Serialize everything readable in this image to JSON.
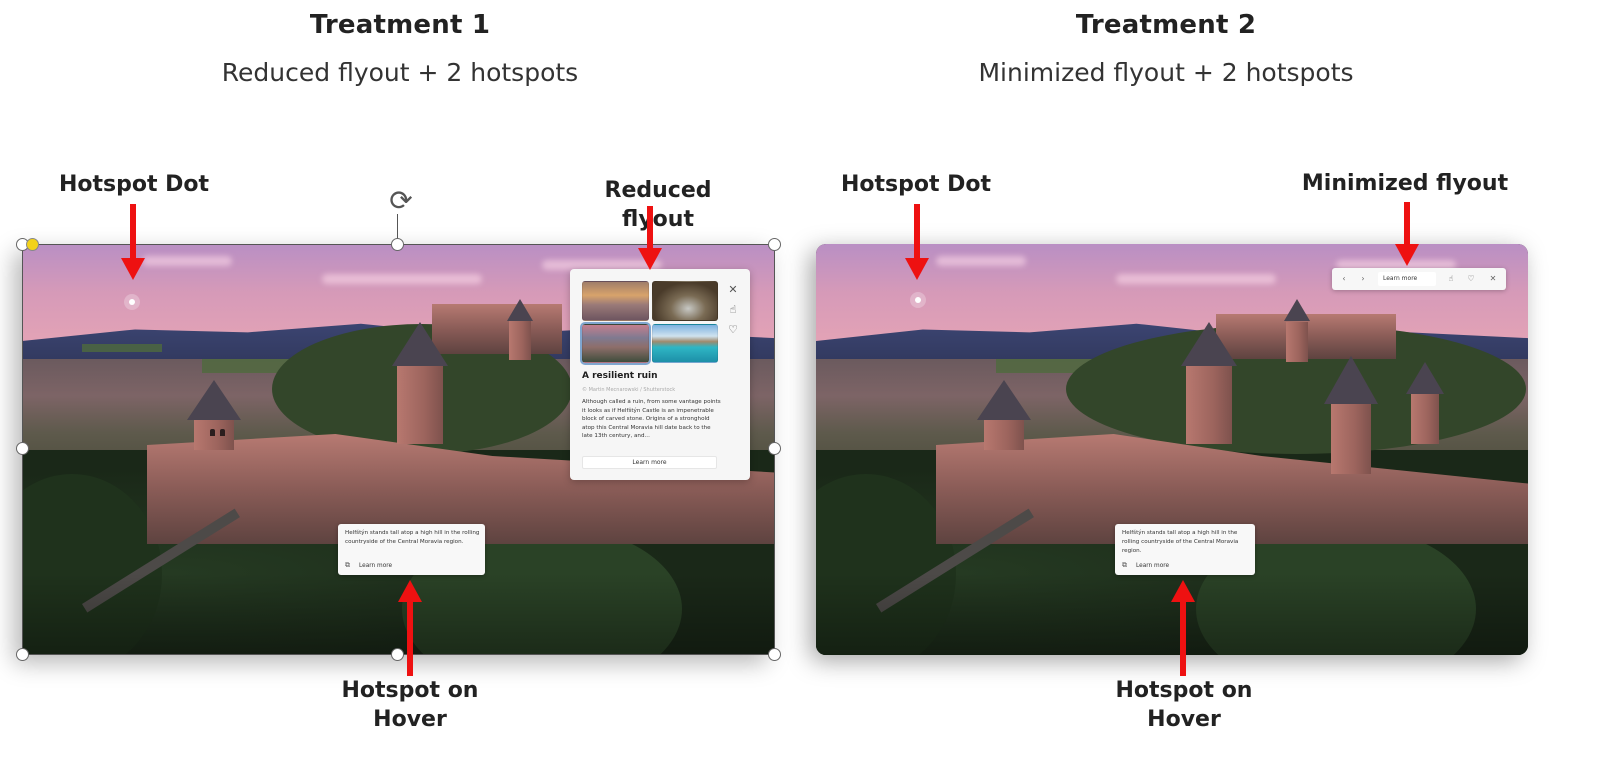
{
  "treatment1": {
    "title": "Treatment 1",
    "subtitle": "Reduced flyout + 2 hotspots",
    "labels": {
      "hotspot_dot": "Hotspot Dot",
      "flyout": "Reduced flyout",
      "hotspot_hover_line1": "Hotspot on",
      "hotspot_hover_line2": "Hover"
    },
    "flyout": {
      "title": "A resilient ruin",
      "credit": "© Martin Mecnarowski / Shutterstock",
      "body": "Although called a ruin, from some vantage points it looks as if Helfštýn Castle is an impenetrable block of carved stone. Origins of a stronghold atop this Central Moravia hill date back to the late 13th century, and...",
      "button": "Learn more",
      "icons": [
        "close-icon",
        "like-icon",
        "dislike-icon"
      ]
    },
    "hover_card": {
      "text": "Helfštýn stands tall atop a high hill in the rolling countryside of the Central Moravia region.",
      "link": "Learn more",
      "icon": "external-link-icon"
    }
  },
  "treatment2": {
    "title": "Treatment 2",
    "subtitle": "Minimized flyout + 2 hotspots",
    "labels": {
      "hotspot_dot": "Hotspot Dot",
      "flyout": "Minimized flyout",
      "hotspot_hover_line1": "Hotspot on",
      "hotspot_hover_line2": "Hover"
    },
    "mini_flyout": {
      "prev": "‹",
      "next": "›",
      "button": "Learn more",
      "like": "♡",
      "close": "✕"
    },
    "hover_card": {
      "text": "Helfštýn stands tall atop a high hill in the rolling countryside of the Central Moravia region.",
      "link": "Learn more",
      "icon": "external-link-icon"
    }
  },
  "glyphs": {
    "close": "✕",
    "like": "👍",
    "dislike": "♡",
    "external": "⧉",
    "rotate": "⟳"
  },
  "colors": {
    "arrow": "#ee1111",
    "handle_yellow": "#f3d21a"
  }
}
